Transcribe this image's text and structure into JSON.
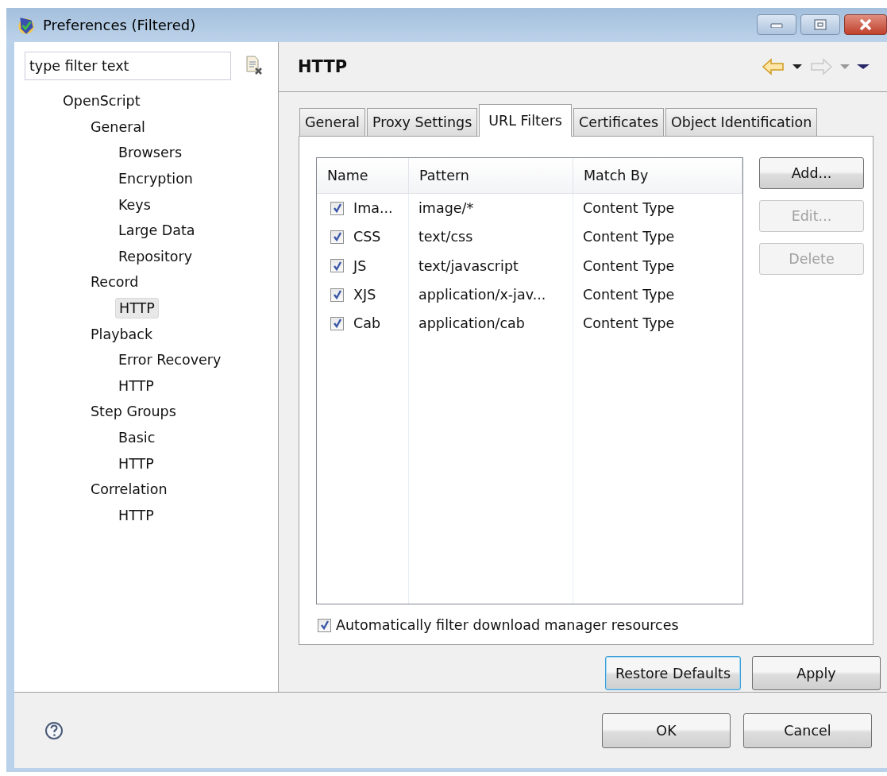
{
  "window": {
    "title": "Preferences (Filtered)"
  },
  "filter": {
    "placeholder": "type filter text"
  },
  "tree": [
    {
      "label": "OpenScript",
      "selected": false,
      "children": [
        {
          "label": "General",
          "selected": false,
          "children": [
            {
              "label": "Browsers",
              "selected": false
            },
            {
              "label": "Encryption",
              "selected": false
            },
            {
              "label": "Keys",
              "selected": false
            },
            {
              "label": "Large Data",
              "selected": false
            },
            {
              "label": "Repository",
              "selected": false
            }
          ]
        },
        {
          "label": "Record",
          "selected": false,
          "children": [
            {
              "label": "HTTP",
              "selected": true
            }
          ]
        },
        {
          "label": "Playback",
          "selected": false,
          "children": [
            {
              "label": "Error Recovery",
              "selected": false
            },
            {
              "label": "HTTP",
              "selected": false
            }
          ]
        },
        {
          "label": "Step Groups",
          "selected": false,
          "children": [
            {
              "label": "Basic",
              "selected": false
            },
            {
              "label": "HTTP",
              "selected": false
            }
          ]
        },
        {
          "label": "Correlation",
          "selected": false,
          "children": [
            {
              "label": "HTTP",
              "selected": false
            }
          ]
        }
      ]
    }
  ],
  "page": {
    "title": "HTTP"
  },
  "tabs": [
    {
      "label": "General",
      "selected": false
    },
    {
      "label": "Proxy Settings",
      "selected": false
    },
    {
      "label": "URL Filters",
      "selected": true
    },
    {
      "label": "Certificates",
      "selected": false
    },
    {
      "label": "Object Identification",
      "selected": false
    }
  ],
  "table": {
    "columns": [
      "Name",
      "Pattern",
      "Match By"
    ],
    "rows": [
      {
        "checked": true,
        "name": "Ima...",
        "pattern": "image/*",
        "match_by": "Content Type"
      },
      {
        "checked": true,
        "name": "CSS",
        "pattern": "text/css",
        "match_by": "Content Type"
      },
      {
        "checked": true,
        "name": "JS",
        "pattern": "text/javascript",
        "match_by": "Content Type"
      },
      {
        "checked": true,
        "name": "XJS",
        "pattern": "application/x-jav...",
        "match_by": "Content Type"
      },
      {
        "checked": true,
        "name": "Cab",
        "pattern": "application/cab",
        "match_by": "Content Type"
      }
    ]
  },
  "side_buttons": [
    {
      "label": "Add...",
      "disabled": false
    },
    {
      "label": "Edit...",
      "disabled": true
    },
    {
      "label": "Delete",
      "disabled": true
    }
  ],
  "auto_filter": {
    "label": "Automatically filter download manager resources",
    "checked": true
  },
  "page_buttons": [
    {
      "label": "Restore Defaults",
      "focused": true
    },
    {
      "label": "Apply",
      "focused": false
    }
  ],
  "dialog_buttons": [
    "OK",
    "Cancel"
  ]
}
